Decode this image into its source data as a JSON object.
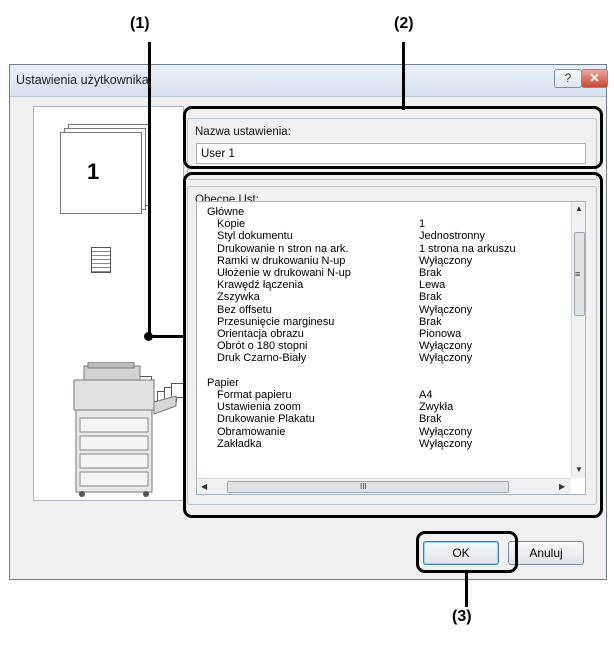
{
  "callouts": {
    "c1": "(1)",
    "c2": "(2)",
    "c3": "(3)"
  },
  "dialog": {
    "title": "Ustawienia użytkownika",
    "help_glyph": "?",
    "close_glyph": "✕"
  },
  "preview": {
    "page_number": "1"
  },
  "name_group": {
    "label": "Nazwa ustawienia:",
    "value": "User 1"
  },
  "current_group": {
    "label": "Obecne Ust:",
    "sections": [
      {
        "title": "Główne",
        "items": [
          [
            "Kopie",
            "1"
          ],
          [
            "Styl dokumentu",
            "Jednostronny"
          ],
          [
            "Drukowanie n stron na ark.",
            "1 strona na arkuszu"
          ],
          [
            "Ramki w drukowaniu N-up",
            "Wyłączony"
          ],
          [
            "Ułożenie w drukowani N-up",
            "Brak"
          ],
          [
            "Krawędź łączenia",
            "Lewa"
          ],
          [
            "Zszywka",
            "Brak"
          ],
          [
            "Bez offsetu",
            "Wyłączony"
          ],
          [
            "Przesunięcie marginesu",
            "Brak"
          ],
          [
            "Orientacja obrazu",
            "Pionowa"
          ],
          [
            "Obrót o 180 stopni",
            "Wyłączony"
          ],
          [
            "Druk Czarno-Biały",
            "Wyłączony"
          ]
        ]
      },
      {
        "title": "Papier",
        "items": [
          [
            "Format papieru",
            "A4"
          ],
          [
            "Ustawienia zoom",
            "Zwykła"
          ],
          [
            "Drukowanie Plakatu",
            "Brak"
          ],
          [
            "Obramowanie",
            "Wyłączony"
          ],
          [
            "Zakładka",
            "Wyłączony"
          ]
        ]
      }
    ],
    "scroll_up": "▲",
    "scroll_down": "▼",
    "scroll_left": "◀",
    "scroll_right": "▶",
    "thumb_grip_v": "≡",
    "thumb_grip_h": "III"
  },
  "buttons": {
    "ok": "OK",
    "cancel": "Anuluj"
  }
}
